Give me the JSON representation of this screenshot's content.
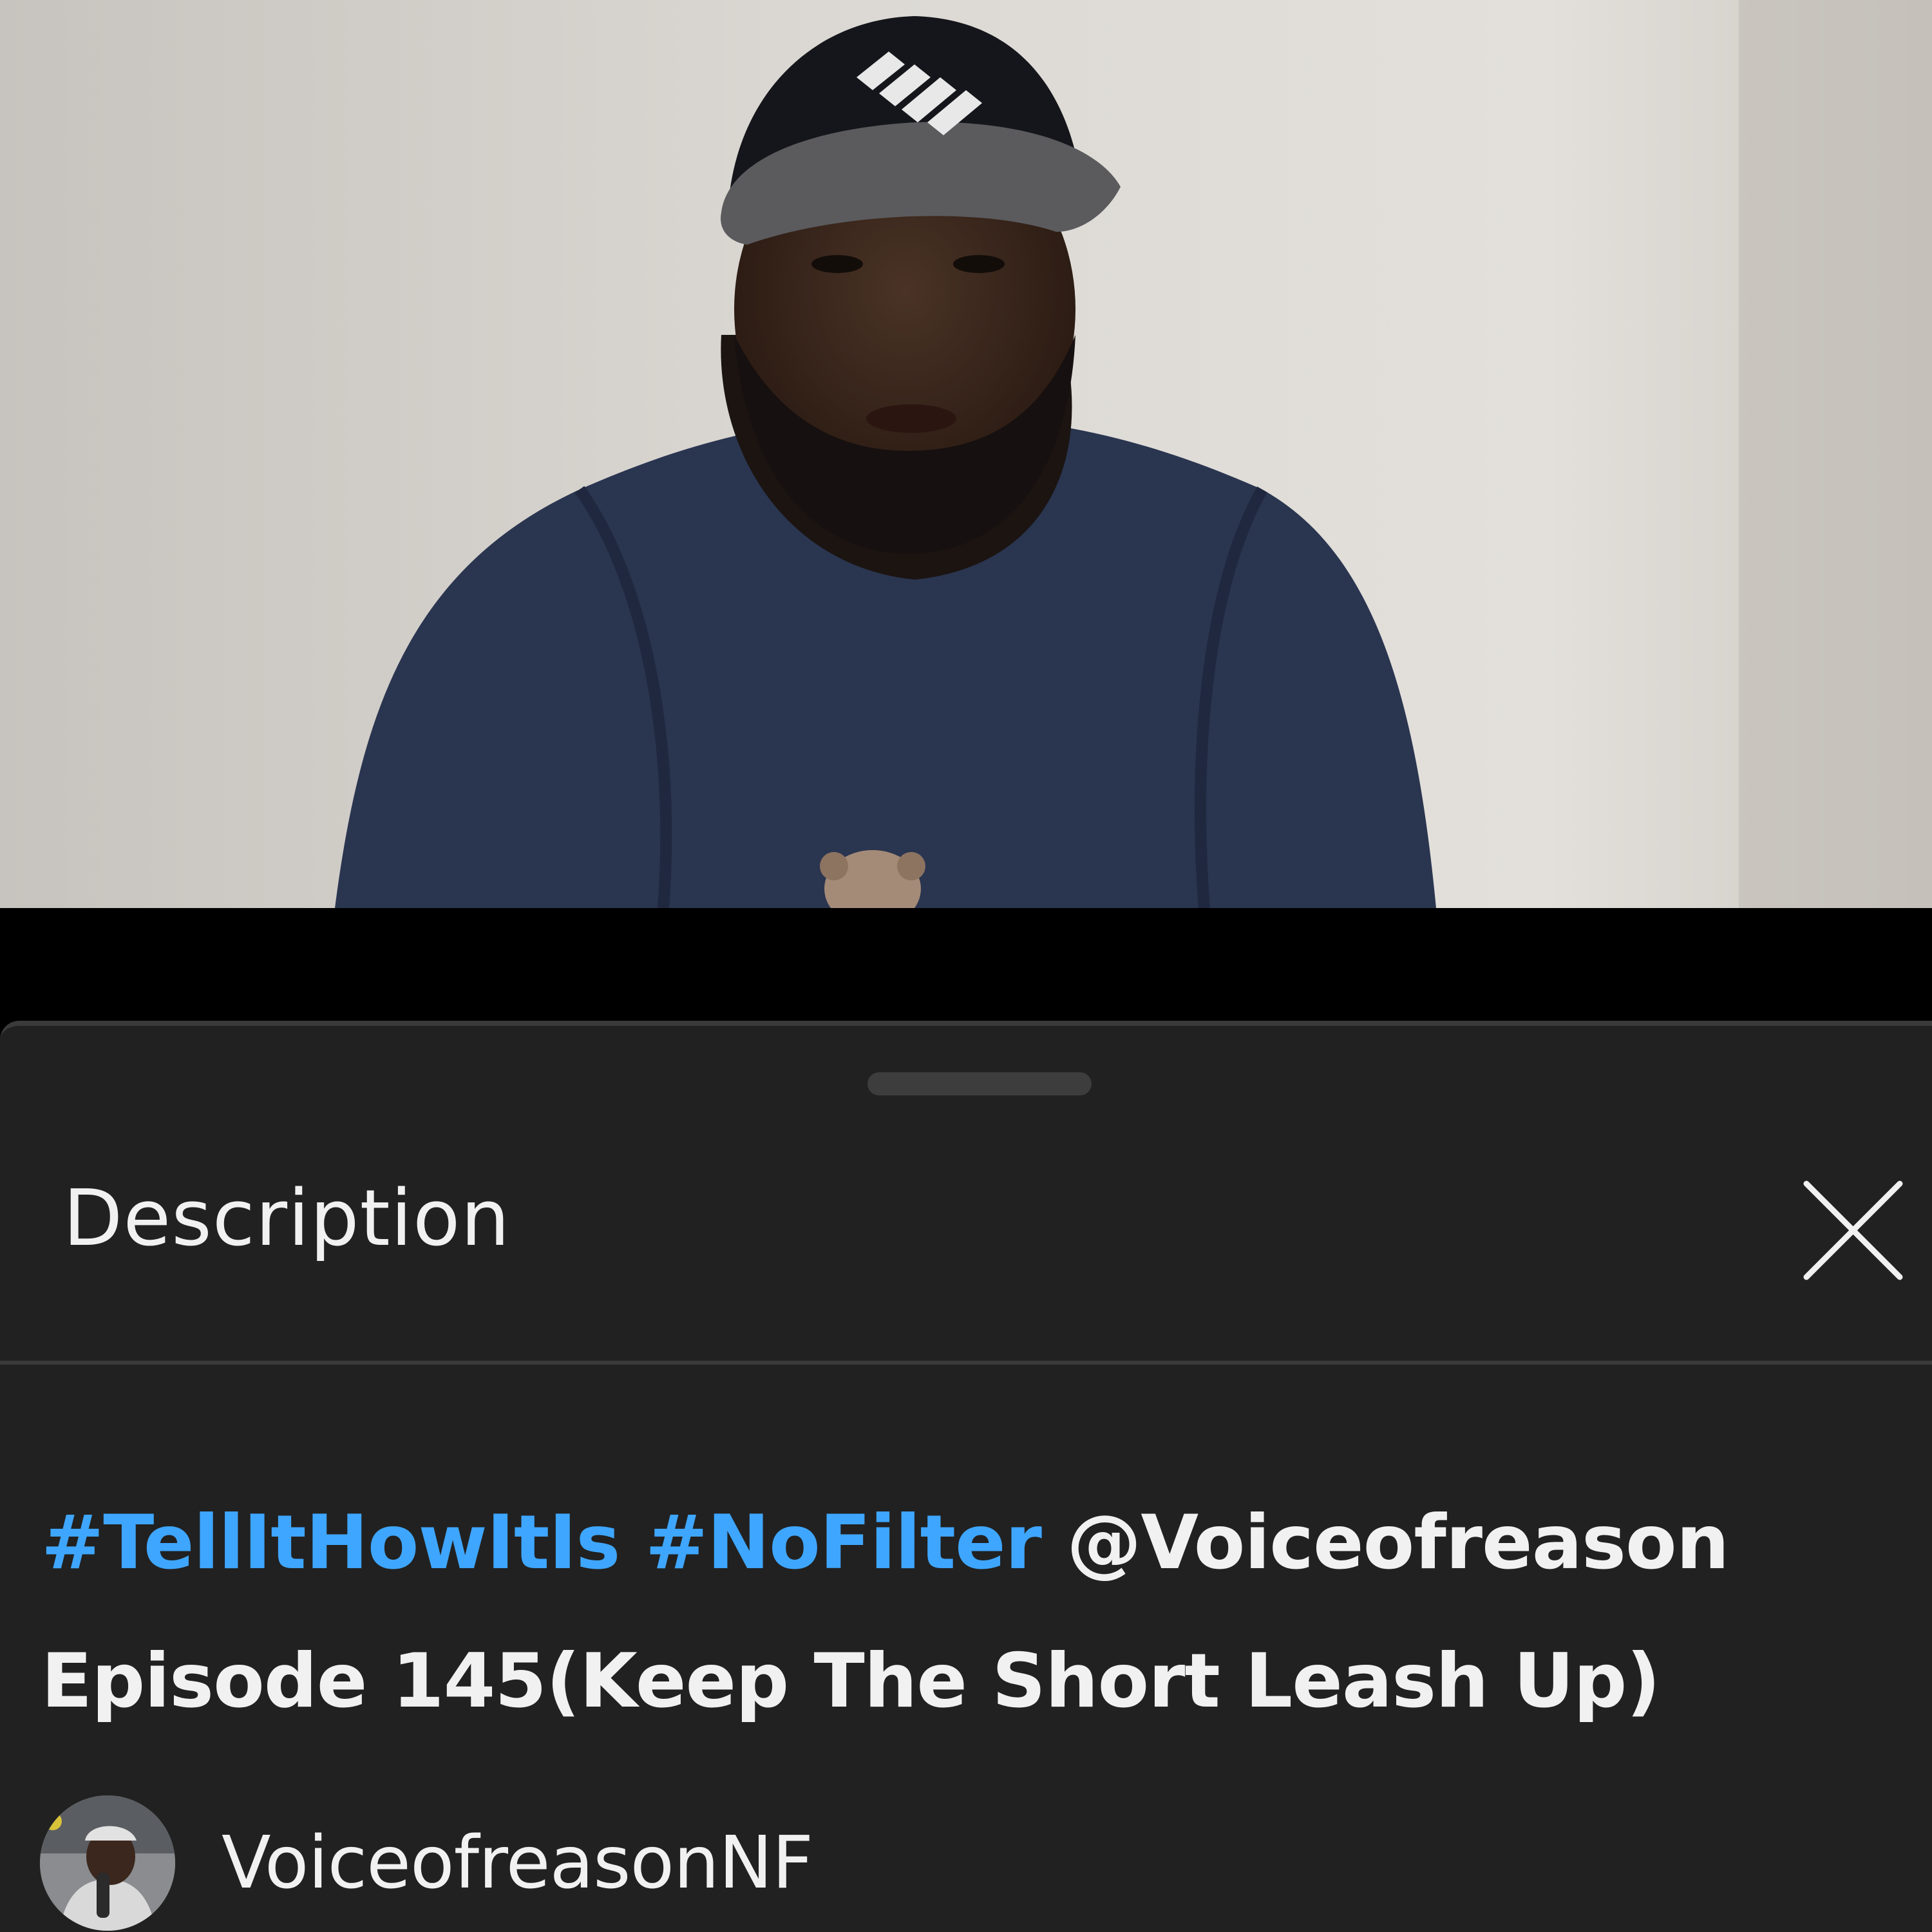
{
  "sheet": {
    "title": "Description",
    "close_icon": "close-icon"
  },
  "video": {
    "title_parts": {
      "hashtag_1": "#TellItHowItIs",
      "hashtag_2": "#NoFilter",
      "mention": "@Voiceofreason",
      "episode": "Episode 145(Keep The Short Leash Up)"
    },
    "channel": {
      "name": "VoiceofreasonNF",
      "avatar": "channel-avatar"
    }
  },
  "colors": {
    "background": "#212121",
    "text": "#f1f1f1",
    "hashtag": "#3ea6ff",
    "divider": "#3a3a3a"
  }
}
